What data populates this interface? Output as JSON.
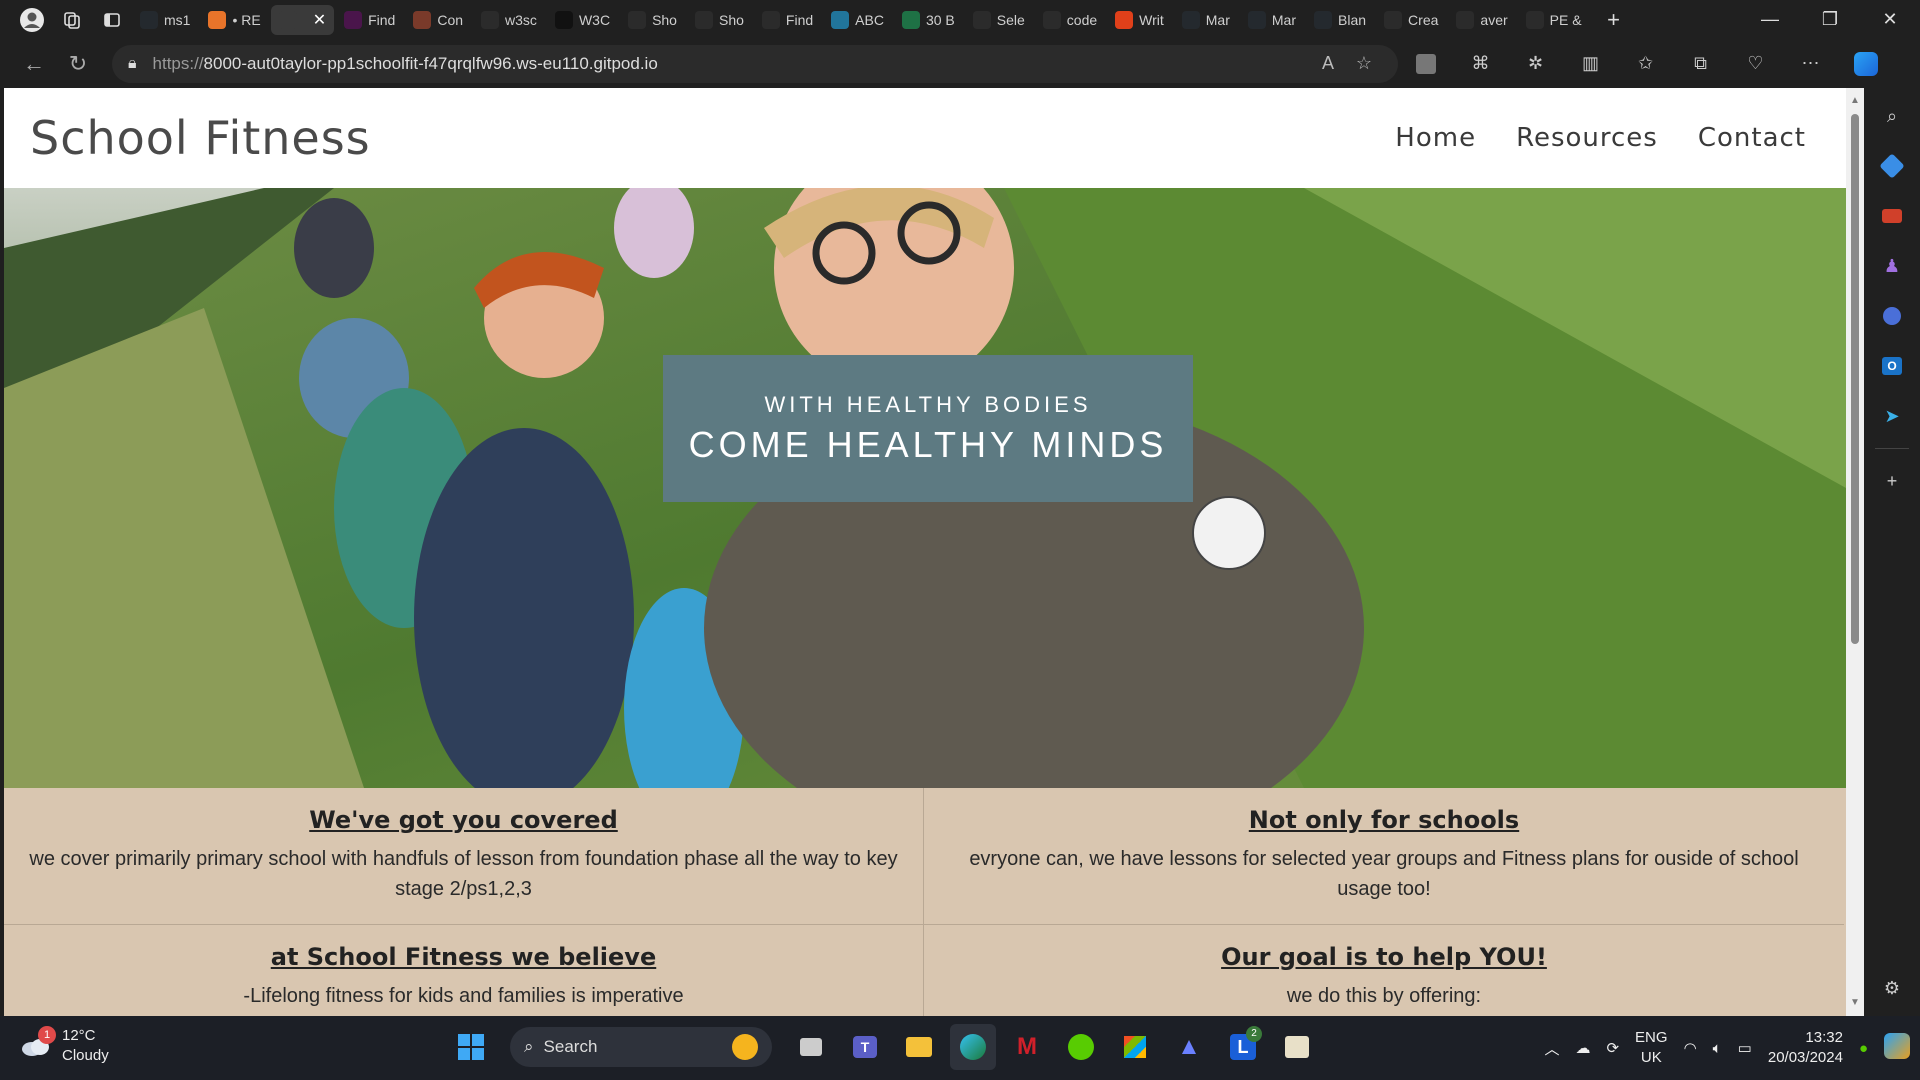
{
  "browser": {
    "tabs": [
      {
        "label": "ms1",
        "icon": "github-icon",
        "color": "#24292e"
      },
      {
        "label": "• RE",
        "icon": "grammarly-icon",
        "color": "#e8742a"
      },
      {
        "label": "",
        "icon": "page-icon",
        "color": "#3a3a3a",
        "active": true
      },
      {
        "label": "Find",
        "icon": "slack-icon",
        "color": "#4a154b"
      },
      {
        "label": "Con",
        "icon": "image-icon",
        "color": "#7a3a2a"
      },
      {
        "label": "w3sc",
        "icon": "search-icon",
        "color": "#2b2b2b"
      },
      {
        "label": "W3C",
        "icon": "w3c-icon",
        "color": "#111111"
      },
      {
        "label": "Sho",
        "icon": "nu-icon",
        "color": "#2b2b2b"
      },
      {
        "label": "Sho",
        "icon": "nu-icon",
        "color": "#2b2b2b"
      },
      {
        "label": "Find",
        "icon": "flag-icon",
        "color": "#2b2b2b"
      },
      {
        "label": "ABC",
        "icon": "wordpress-icon",
        "color": "#21759b"
      },
      {
        "label": "30 B",
        "icon": "sheet-icon",
        "color": "#1e7145"
      },
      {
        "label": "Sele",
        "icon": "script-icon",
        "color": "#2b2b2b"
      },
      {
        "label": "code",
        "icon": "search-icon",
        "color": "#2b2b2b"
      },
      {
        "label": "Writ",
        "icon": "circle-icon",
        "color": "#e0401a"
      },
      {
        "label": "Mar",
        "icon": "github-icon",
        "color": "#24292e"
      },
      {
        "label": "Mar",
        "icon": "github-icon",
        "color": "#24292e"
      },
      {
        "label": "Blan",
        "icon": "github-icon",
        "color": "#24292e"
      },
      {
        "label": "Crea",
        "icon": "globe-icon",
        "color": "#2b2b2b"
      },
      {
        "label": "aver",
        "icon": "search-icon",
        "color": "#2b2b2b"
      },
      {
        "label": "PE &",
        "icon": "feather-icon",
        "color": "#2b2b2b"
      }
    ],
    "new_tab_label": "+",
    "url_scheme": "https://",
    "url_host": "8000-aut0taylor-pp1schoolfit-f47qrqlfw96.ws-eu110.gitpod.io"
  },
  "site": {
    "logo": "School Fitness",
    "nav": [
      "Home",
      "Resources",
      "Contact"
    ],
    "hero": {
      "subtitle": "WITH HEALTHY BODIES",
      "title": "COME HEALTHY MINDS"
    },
    "cards": [
      {
        "title": "We've got you covered",
        "text": "we cover primarily primary school with handfuls of lesson from foundation phase all the way to key stage 2/ps1,2,3"
      },
      {
        "title": "Not only for schools",
        "text": "evryone can, we have lessons for selected year groups and Fitness plans for ouside of school usage too!"
      },
      {
        "title": "at School Fitness we believe",
        "text": "-Lifelong fitness for kids and families is imperative"
      },
      {
        "title": "Our goal is to help YOU!",
        "text": "we do this by offering:"
      }
    ]
  },
  "taskbar": {
    "weather_temp": "12°C",
    "weather_desc": "Cloudy",
    "weather_badge": "1",
    "search_label": "Search",
    "lang_top": "ENG",
    "lang_bottom": "UK",
    "time": "13:32",
    "date": "20/03/2024",
    "app_badge": "2"
  },
  "colors": {
    "hero_box": "#5d7a82",
    "card_bg": "#d9c6b0"
  }
}
